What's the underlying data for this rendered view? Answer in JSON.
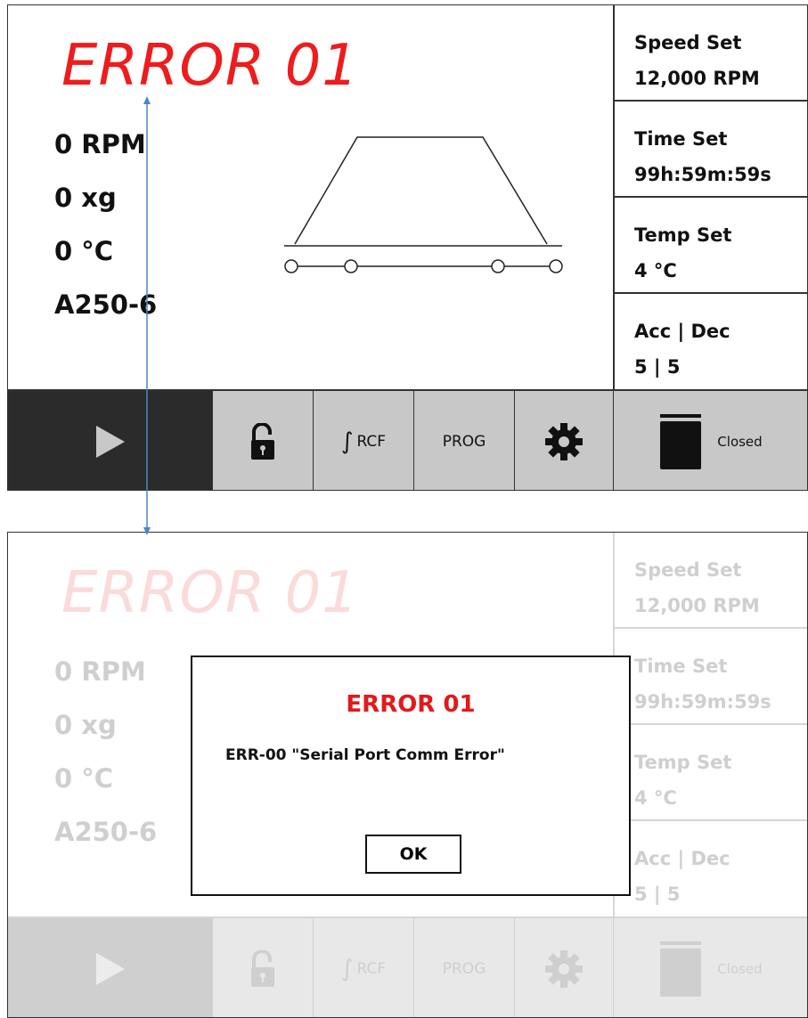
{
  "screens": [
    {
      "error_title": "ERROR 01",
      "readings": [
        "0 RPM",
        "0 xg",
        "0 °C",
        "A250-6"
      ],
      "settings": [
        {
          "label": "Speed Set",
          "value": "12,000 RPM"
        },
        {
          "label": "Time Set",
          "value": "99h:59m:59s"
        },
        {
          "label": "Temp Set",
          "value": "4 °C"
        },
        {
          "label": "Acc | Dec",
          "value": "5 | 5"
        }
      ],
      "toolbar": {
        "play_icon": "play-icon",
        "lock_icon": "unlock-icon",
        "rcf_symbol": "∫",
        "rcf_label": "RCF",
        "prog_label": "PROG",
        "gear_icon": "gear-icon",
        "lid_icon": "lid-icon",
        "lid_status": "Closed"
      }
    },
    {
      "error_title": "ERROR 01",
      "readings": [
        "0 RPM",
        "0 xg",
        "0 °C",
        "A250-6"
      ],
      "settings": [
        {
          "label": "Speed Set",
          "value": "12,000 RPM"
        },
        {
          "label": "Time Set",
          "value": "99h:59m:59s"
        },
        {
          "label": "Temp Set",
          "value": "4 °C"
        },
        {
          "label": "Acc | Dec",
          "value": "5 | 5"
        }
      ],
      "toolbar": {
        "play_icon": "play-icon",
        "lock_icon": "unlock-icon",
        "rcf_symbol": "∫",
        "rcf_label": "RCF",
        "prog_label": "PROG",
        "gear_icon": "gear-icon",
        "lid_icon": "lid-icon",
        "lid_status": "Closed"
      }
    }
  ],
  "dialog": {
    "title": "ERROR 01",
    "message": "ERR-00 \"Serial Port Comm Error\"",
    "ok_label": "OK"
  },
  "colors": {
    "error_red": "#ee1c1c",
    "play_bg": "#2b2b2b",
    "button_bg": "#c8c8c8",
    "connector": "#4a86c8"
  }
}
